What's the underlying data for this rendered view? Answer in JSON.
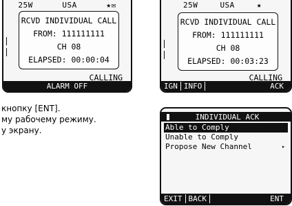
{
  "screen1": {
    "status": {
      "power": "25W",
      "region": "USA",
      "star": "★",
      "mail": "✉"
    },
    "call": {
      "line1": "RCVD INDIVIDUAL CALL",
      "line2": "FROM: 111111111",
      "line3": "CH 08",
      "line4": "ELAPSED: 00:00:04"
    },
    "calling": "CALLING",
    "softkey": "ALARM OFF"
  },
  "screen2": {
    "status": {
      "power": "25W",
      "region": "USA",
      "star": "★"
    },
    "call": {
      "line1": "RCVD INDIVIDUAL CALL",
      "line2": "FROM: 111111111",
      "line3": "CH 08",
      "line4": "ELAPSED: 00:03:23"
    },
    "calling": "CALLING",
    "softkeys": {
      "ign": "IGN",
      "info": "INFO",
      "ack": "ACK"
    }
  },
  "screen3": {
    "title": "INDIVIDUAL ACK",
    "menu": [
      "Able to Comply",
      "Unable to Comply",
      "Propose New Channel"
    ],
    "submenu_arrow": "▸",
    "softkeys": {
      "exit": "EXIT",
      "back": "BACK",
      "ent": "ENT"
    }
  },
  "instructions": {
    "line1": "кнопку [ENT].",
    "line2": "му рабочему режиму.",
    "line3": "у экрану."
  }
}
